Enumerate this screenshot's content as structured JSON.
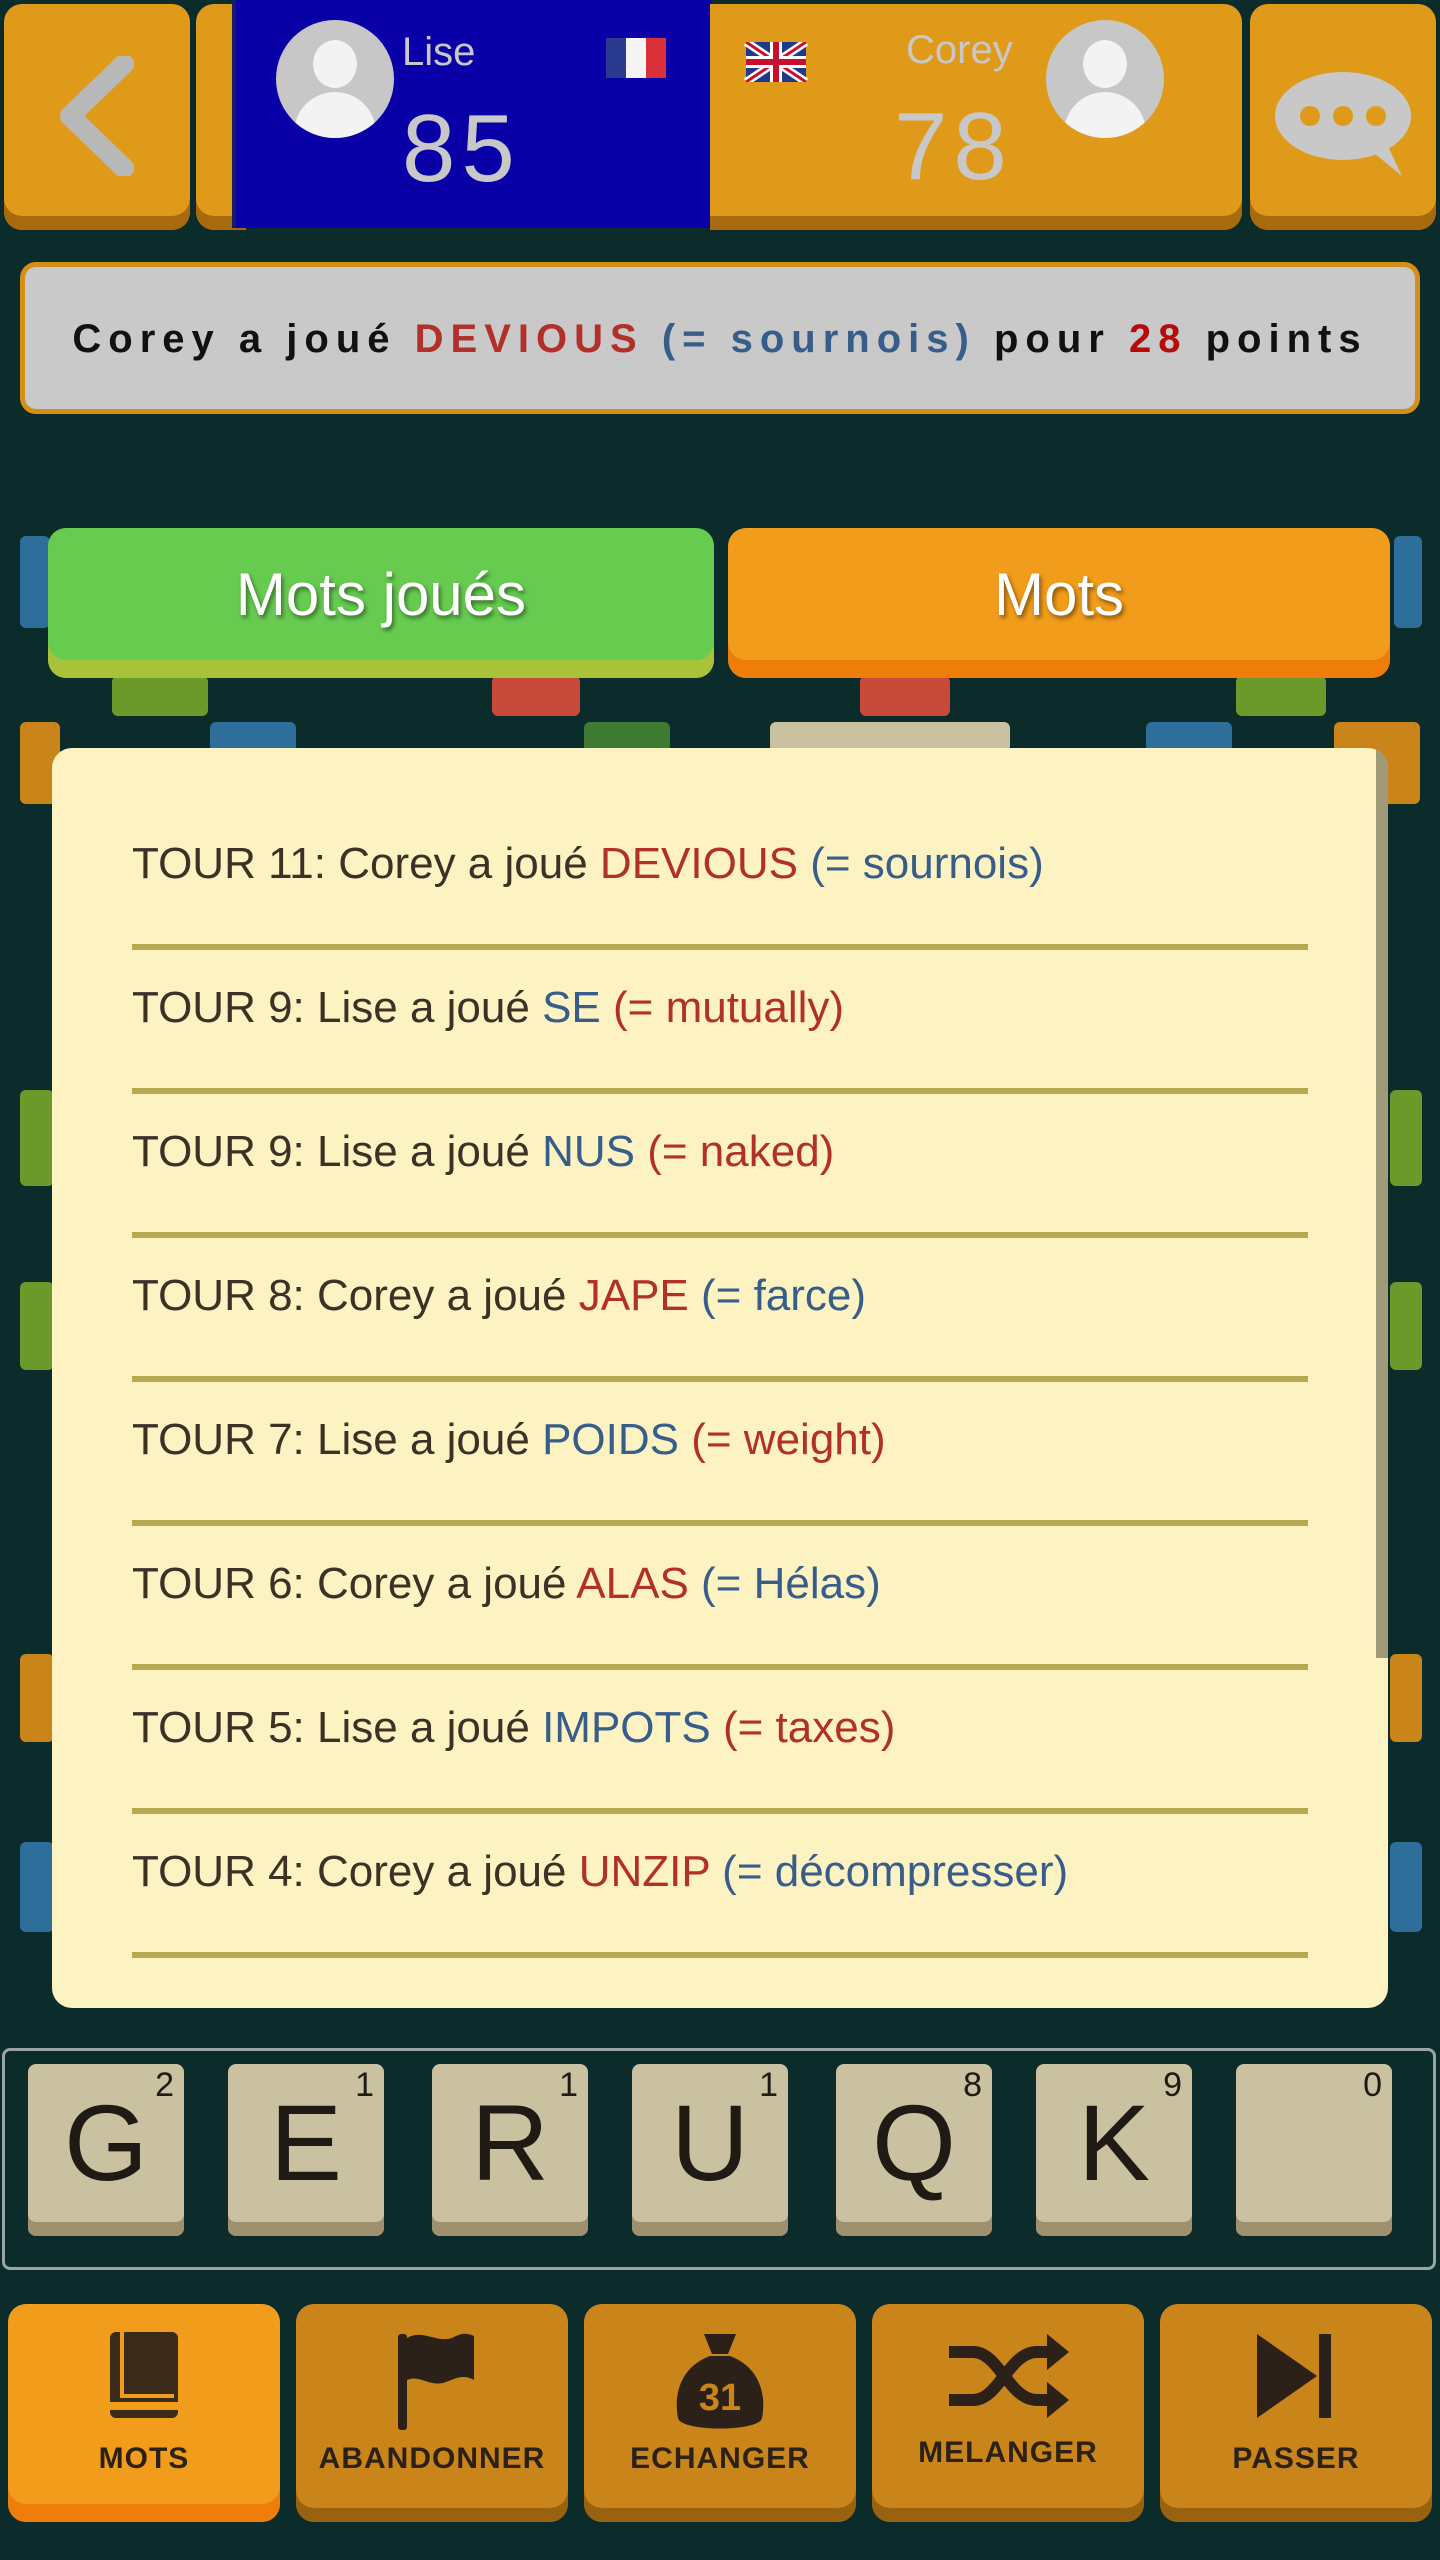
{
  "players": {
    "left": {
      "name": "Lise",
      "score": "85",
      "flag": "france-flag-icon"
    },
    "right": {
      "name": "Corey",
      "score": "78",
      "flag": "uk-flag-icon"
    }
  },
  "notification": {
    "player": "Corey",
    "verb": "a joué",
    "word": "DEVIOUS",
    "translation": "(= sournois)",
    "mid": "pour",
    "points": "28",
    "unit": "points"
  },
  "tabs": {
    "played": "Mots joués",
    "words": "Mots"
  },
  "turns": [
    {
      "prefix": "TOUR 11: Corey a joué",
      "word": "DEVIOUS",
      "translation": "(= sournois)",
      "player_color": "red"
    },
    {
      "prefix": "TOUR 9: Lise a joué",
      "word": "SE",
      "translation": "(= mutually)",
      "player_color": "blue"
    },
    {
      "prefix": "TOUR 9: Lise a joué",
      "word": "NUS",
      "translation": "(= naked)",
      "player_color": "blue"
    },
    {
      "prefix": "TOUR 8: Corey a joué",
      "word": "JAPE",
      "translation": "(= farce)",
      "player_color": "red"
    },
    {
      "prefix": "TOUR 7: Lise a joué",
      "word": "POIDS",
      "translation": "(= weight)",
      "player_color": "blue"
    },
    {
      "prefix": "TOUR 6: Corey a joué",
      "word": "ALAS",
      "translation": "(= Hélas)",
      "player_color": "red"
    },
    {
      "prefix": "TOUR 5: Lise a joué",
      "word": "IMPOTS",
      "translation": "(= taxes)",
      "player_color": "blue"
    },
    {
      "prefix": "TOUR 4: Corey a joué",
      "word": "UNZIP",
      "translation": "(= décompresser)",
      "player_color": "red"
    }
  ],
  "rack": [
    {
      "letter": "G",
      "points": "2"
    },
    {
      "letter": "E",
      "points": "1"
    },
    {
      "letter": "R",
      "points": "1"
    },
    {
      "letter": "U",
      "points": "1"
    },
    {
      "letter": "Q",
      "points": "8"
    },
    {
      "letter": "K",
      "points": "9"
    },
    {
      "letter": "",
      "points": "0"
    }
  ],
  "toolbar": {
    "words": "MOTS",
    "abandon": "ABANDONNER",
    "exchange": "ECHANGER",
    "bag_count": "31",
    "shuffle": "MELANGER",
    "pass": "PASSER"
  },
  "colors": {
    "red_word": "#b1302a",
    "blue_word": "#375d8a",
    "accent_orange": "#f19c1a",
    "accent_green": "#67cb50",
    "player_left_bg": "#0a00a8"
  }
}
